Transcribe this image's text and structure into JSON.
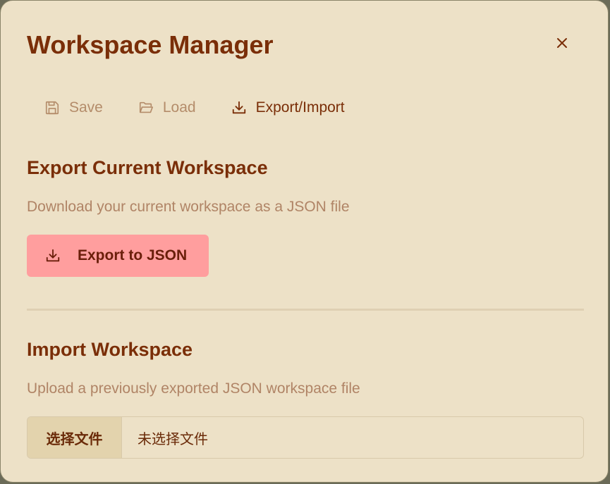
{
  "dialog": {
    "title": "Workspace Manager",
    "close_icon": "close-icon"
  },
  "tabs": [
    {
      "label": "Save",
      "icon": "save-icon",
      "active": false
    },
    {
      "label": "Load",
      "icon": "folder-open-icon",
      "active": false
    },
    {
      "label": "Export/Import",
      "icon": "download-icon",
      "active": true
    }
  ],
  "export": {
    "title": "Export Current Workspace",
    "description": "Download your current workspace as a JSON file",
    "button_label": "Export to JSON",
    "button_icon": "download-icon"
  },
  "import": {
    "title": "Import Workspace",
    "description": "Upload a previously exported JSON workspace file",
    "choose_file_label": "选择文件",
    "no_file_label": "未选择文件"
  },
  "colors": {
    "background": "#ede1c7",
    "title": "#7a2e08",
    "muted": "#b08466",
    "accent_button": "#ff9e9e"
  }
}
